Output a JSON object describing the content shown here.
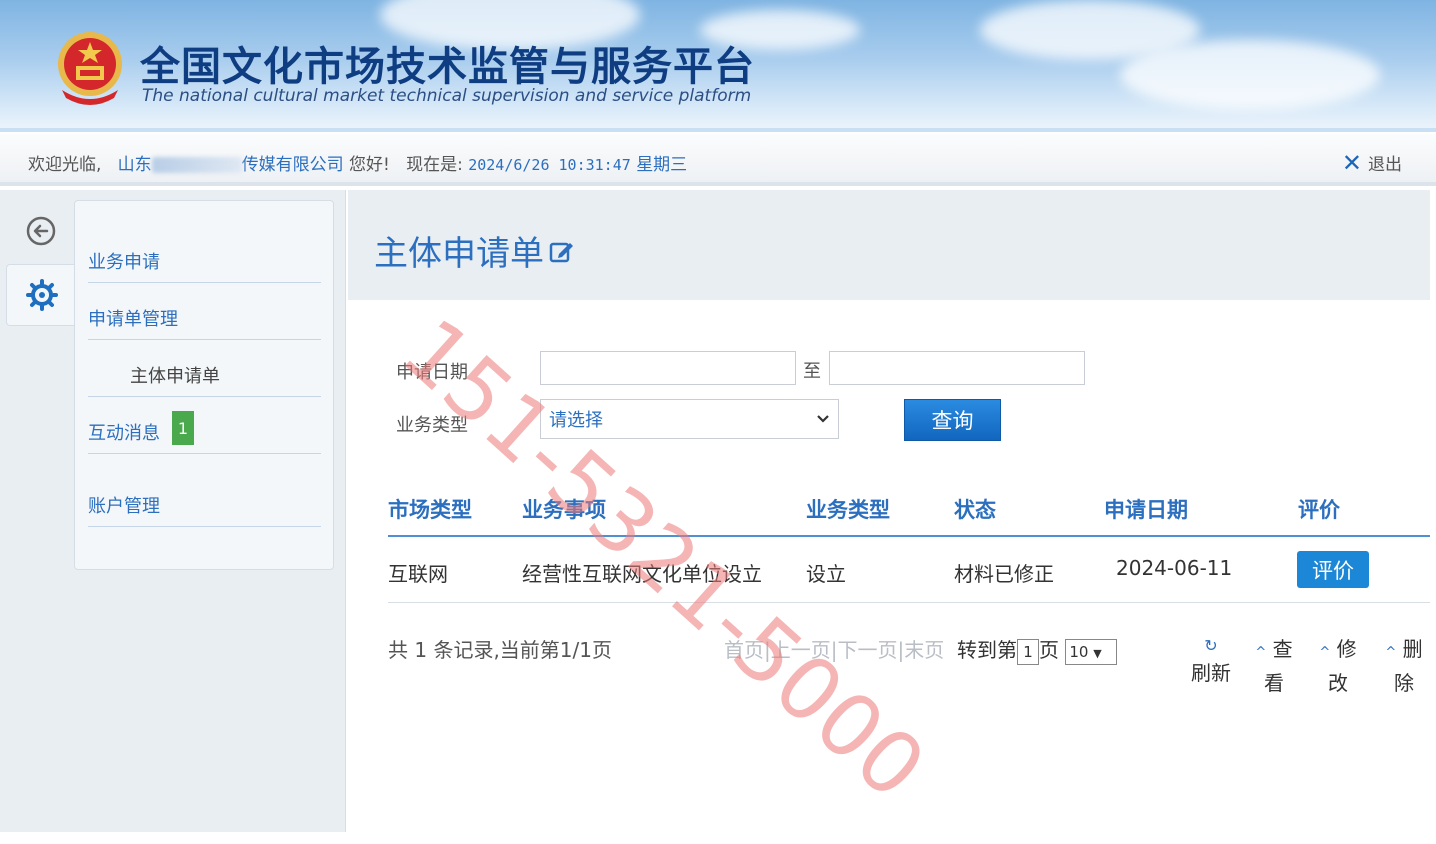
{
  "header": {
    "title_cn": "全国文化市场技术监管与服务平台",
    "title_en": "The national cultural market technical supervision and service platform"
  },
  "welcome": {
    "greeting": "欢迎光临,",
    "company_prefix": "山东",
    "company_suffix": "传媒有限公司",
    "hello": "您好!",
    "now_label": "现在是:",
    "datetime": "2024/6/26 10:31:47",
    "weekday": "星期三",
    "logout": "退出"
  },
  "sidebar": {
    "items": [
      {
        "label": "业务申请"
      },
      {
        "label": "申请单管理"
      },
      {
        "label": "主体申请单"
      },
      {
        "label": "互动消息",
        "badge": "1"
      },
      {
        "label": "账户管理"
      }
    ]
  },
  "main": {
    "title": "主体申请单",
    "filters": {
      "date_label": "申请日期",
      "to_label": "至",
      "date_from": "",
      "date_to": "",
      "type_label": "业务类型",
      "type_selected": "请选择",
      "query_button": "查询"
    },
    "table": {
      "headers": [
        "市场类型",
        "业务事项",
        "业务类型",
        "状态",
        "申请日期",
        "评价"
      ],
      "rows": [
        {
          "market": "互联网",
          "matter": "经营性互联网文化单位设立",
          "type": "设立",
          "status": "材料已修正",
          "date": "2024-06-11",
          "action": "评价"
        }
      ]
    },
    "pager": {
      "summary": "共 1 条记录,当前第1/1页",
      "first": "首页",
      "sep1": "|",
      "prev": "上一页",
      "sep2": "|",
      "next": "下一页",
      "sep3": "|",
      "last": "末页",
      "goto": "转到第",
      "page_value": "1",
      "page_unit": "页",
      "page_size": "10",
      "refresh": "刷新",
      "view": [
        "查",
        "看"
      ],
      "edit": [
        "修",
        "改"
      ],
      "delete": [
        "删",
        "除"
      ]
    }
  },
  "watermark": "151-5321-5000",
  "colors": {
    "brand_blue": "#2c6fbf",
    "button_blue": "#1b87d6",
    "badge_green": "#4aa94d"
  }
}
